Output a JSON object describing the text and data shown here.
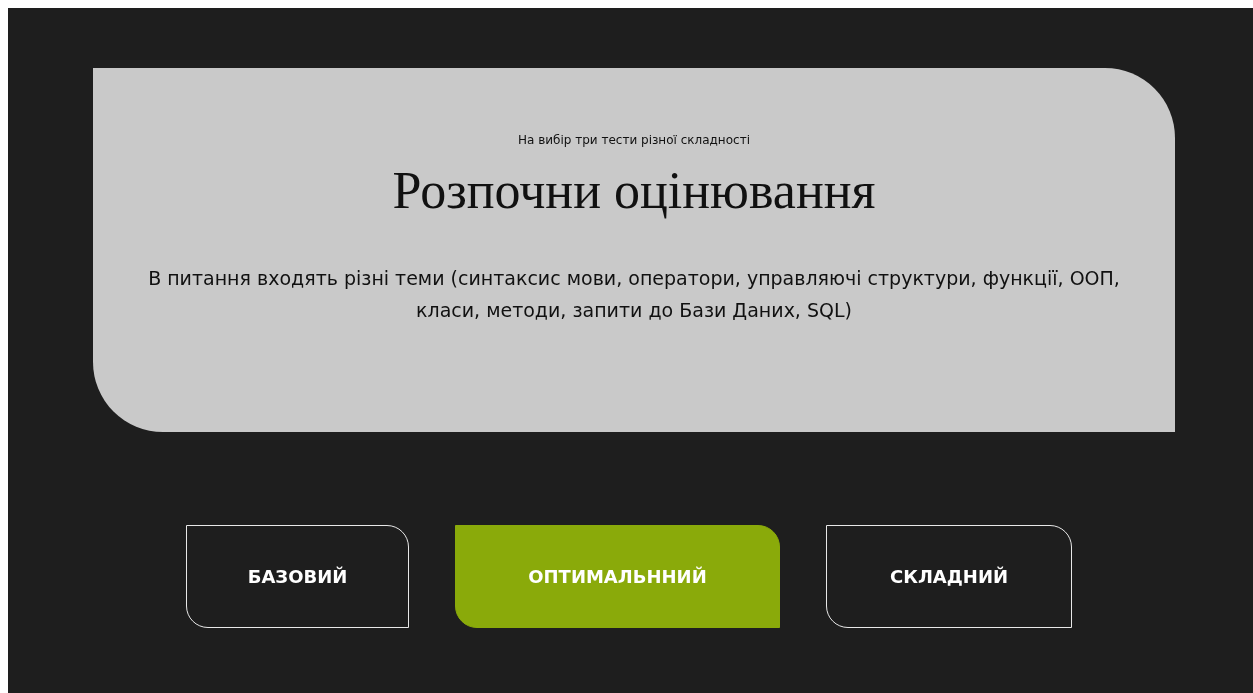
{
  "hero": {
    "subtitle": "На вибір три тести різної складності",
    "title": "Розпочни оцінювання",
    "description": "В питання входять різні теми (синтаксис мови, оператори, управляючі структури, функції, ООП, класи, методи, запити до Бази Даних, SQL)"
  },
  "levels": [
    {
      "label": "БАЗОВИЙ",
      "selected": false
    },
    {
      "label": "ОПТИМАЛЬННИЙ",
      "selected": true
    },
    {
      "label": "СКЛАДНИЙ",
      "selected": false
    }
  ]
}
